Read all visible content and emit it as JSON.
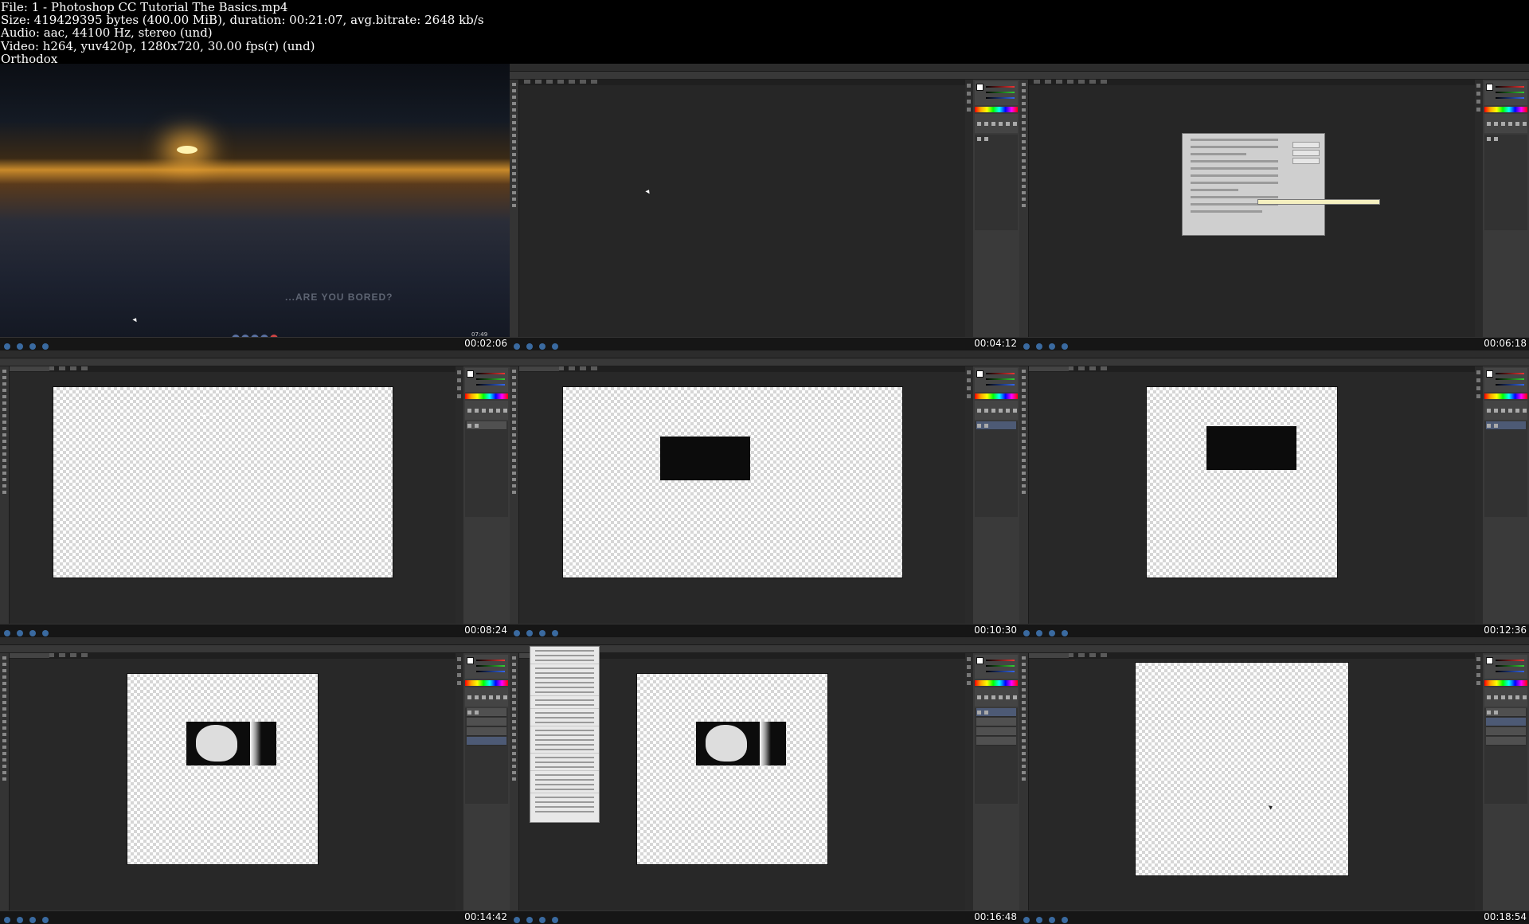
{
  "header": {
    "file": "File: 1 - Photoshop CC Tutorial The Basics.mp4",
    "size": "Size: 419429395 bytes (400.00 MiB), duration: 00:21:07, avg.bitrate: 2648 kb/s",
    "audio": "Audio: aac, 44100 Hz, stereo (und)",
    "video": "Video: h264, yuv420p, 1280x720, 30.00 fps(r) (und)",
    "tag": "Orthodox"
  },
  "tiles": [
    {
      "timestamp": "00:02:06",
      "scene": "desktop"
    },
    {
      "timestamp": "00:04:12",
      "scene": "photoshop-empty"
    },
    {
      "timestamp": "00:06:18",
      "scene": "new-document-dialog"
    },
    {
      "timestamp": "00:08:24",
      "scene": "transparent-canvas"
    },
    {
      "timestamp": "00:10:30",
      "scene": "black-rectangle"
    },
    {
      "timestamp": "00:12:36",
      "scene": "black-rectangle"
    },
    {
      "timestamp": "00:14:42",
      "scene": "masked-shape"
    },
    {
      "timestamp": "00:16:48",
      "scene": "edit-menu-open"
    },
    {
      "timestamp": "00:18:54",
      "scene": "transparent-canvas"
    }
  ],
  "desktop": {
    "headline": "...ARE YOU BORED?",
    "clock": "07:49"
  },
  "colors": {
    "background": "#000000",
    "ps_workspace": "#282828",
    "ps_panel": "#3a3a3a",
    "selected_layer": "#4d5a75"
  }
}
